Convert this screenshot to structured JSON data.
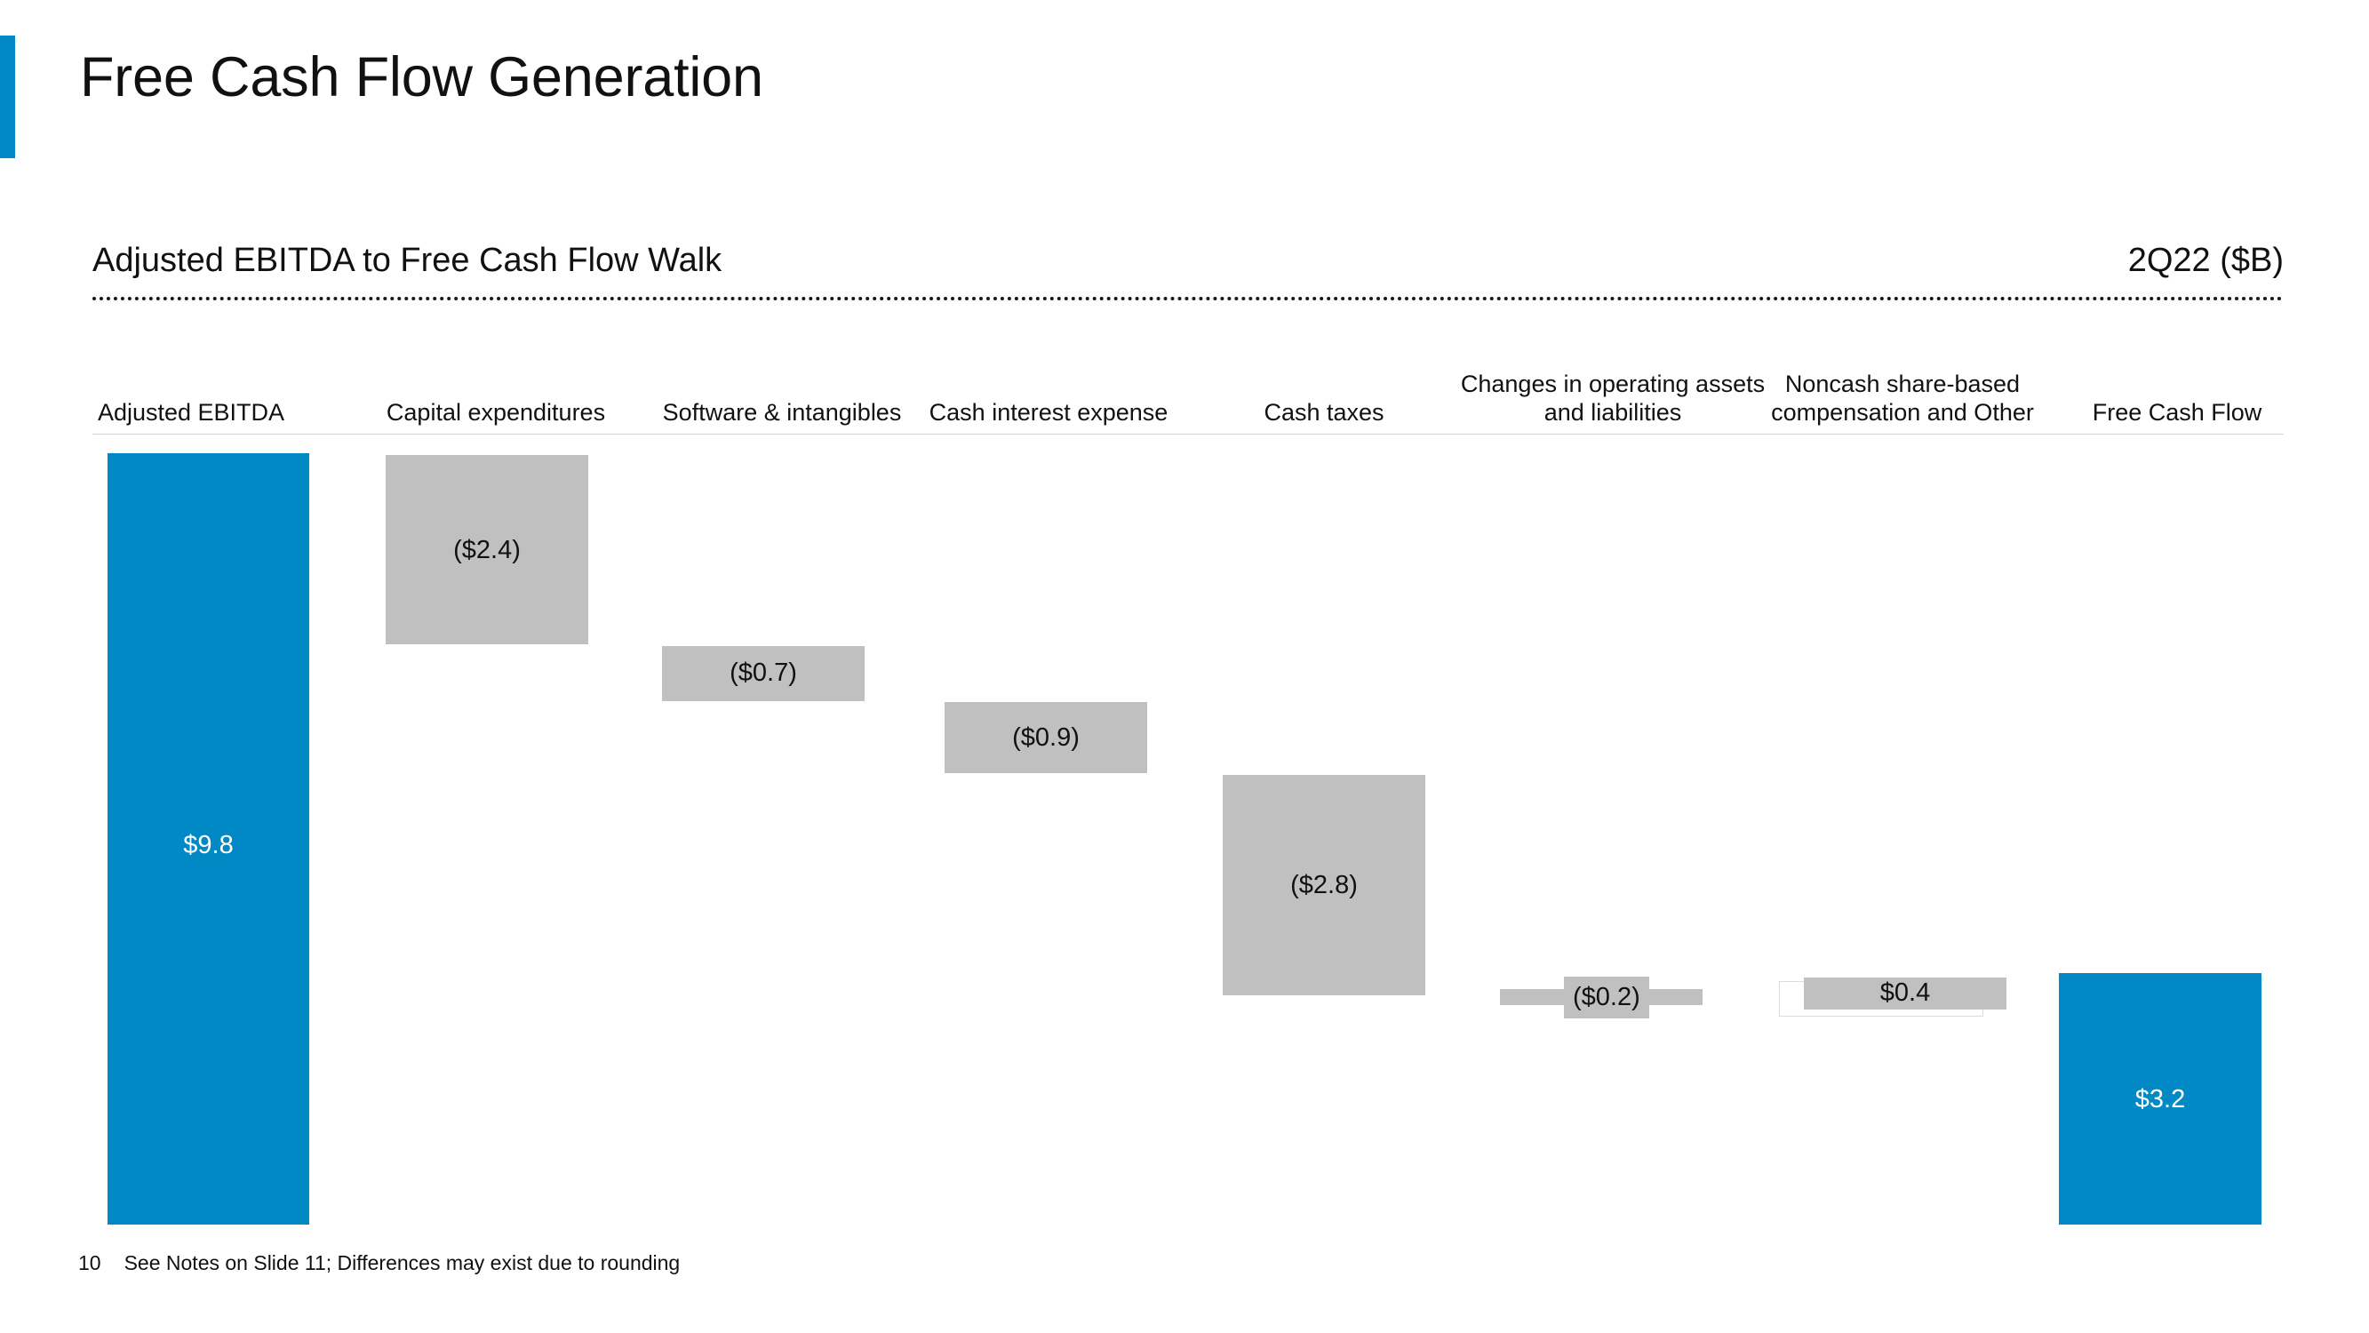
{
  "slide": {
    "title": "Free Cash Flow Generation",
    "page_number": "10",
    "footnote": "See Notes on Slide 11; Differences may exist due to rounding",
    "accent_color": "#0089c4"
  },
  "section": {
    "title": "Adjusted EBITDA to Free Cash Flow Walk",
    "period": "2Q22 ($B)"
  },
  "colors": {
    "total_bar": "#0089c4",
    "delta_bar": "#c0c0c0",
    "axis_rule": "#d2d2d2",
    "text": "#111111"
  },
  "chart_data": {
    "type": "bar",
    "subtype": "waterfall",
    "title": "Adjusted EBITDA to Free Cash Flow Walk",
    "subtitle": "2Q22 ($B)",
    "xlabel": "",
    "ylabel": "",
    "units": "$B",
    "grid": false,
    "legend": "none",
    "ylim": [
      0,
      9.8
    ],
    "categories": [
      "Adjusted EBITDA",
      "Capital expenditures",
      "Software & intangibles",
      "Cash interest expense",
      "Cash taxes",
      "Changes in operating assets and liabilities",
      "Noncash share-based compensation and Other",
      "Free Cash Flow"
    ],
    "labels": [
      "$9.8",
      "($2.4)",
      "($0.7)",
      "($0.9)",
      "($2.8)",
      "($0.2)",
      "$0.4",
      "$3.2"
    ],
    "values": [
      9.8,
      -2.4,
      -0.7,
      -0.9,
      -2.8,
      -0.2,
      0.4,
      3.2
    ],
    "bar_kinds": [
      "total",
      "delta",
      "delta",
      "delta",
      "delta",
      "delta",
      "delta",
      "total"
    ],
    "cumulative_start": [
      0.0,
      7.4,
      6.7,
      5.8,
      3.0,
      2.8,
      2.8,
      0.0
    ],
    "cumulative_end": [
      9.8,
      9.8,
      7.4,
      6.7,
      5.8,
      3.0,
      3.2,
      3.2
    ]
  }
}
